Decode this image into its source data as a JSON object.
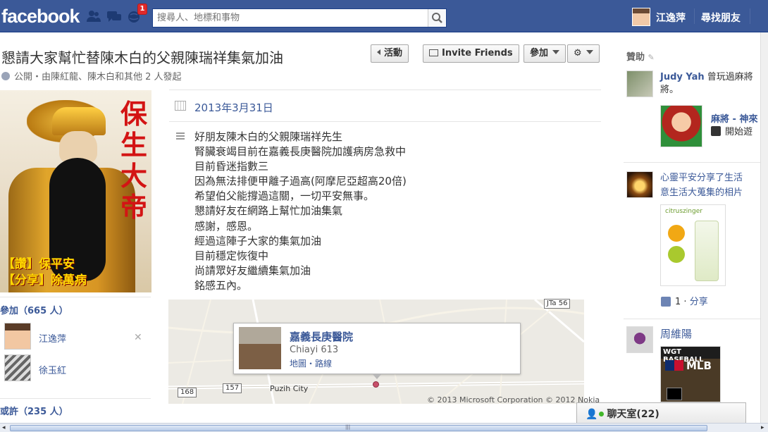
{
  "topbar": {
    "logo": "facebook",
    "notification_count": "1",
    "search_placeholder": "搜尋人、地標和事物",
    "user_name": "江逸萍",
    "find_friends": "尋找朋友"
  },
  "event": {
    "title": "懇請大家幫忙替陳木白的父親陳瑞祥集氣加油",
    "meta": "公開・由陳紅龍、陳木白和其他 2 人發起",
    "buttons": {
      "activity": "活動",
      "invite": "Invite Friends",
      "join": "參加"
    },
    "date": "2013年3月31日",
    "description": [
      "好朋友陳木白的父親陳瑞祥先生",
      "腎臟衰竭目前在嘉義長庚醫院加護病房急救中",
      "目前昏迷指數三",
      "因為無法排便甲離子過高(阿摩尼亞超高20倍)",
      "希望伯父能撐過這關，一切平安無事。",
      "懇請好友在網路上幫忙加油集氣",
      "感謝，感恩。",
      "經過這陣子大家的集氣加油",
      "目前穩定恢復中",
      "尚請眾好友繼續集氣加油",
      "銘感五內。"
    ]
  },
  "poster": {
    "vertical_text": "保生大帝",
    "line1": "【讚】保平安",
    "line2": "【分享】除萬病"
  },
  "left": {
    "going_header": "參加（665 人）",
    "people": [
      "江逸萍",
      "徐玉紅"
    ],
    "maybe_header": "或許（235 人）"
  },
  "map": {
    "place_name": "嘉義長庚醫院",
    "city": "Chiayi 613",
    "links": "地圖・路線",
    "town": "Puzih City",
    "roads": [
      "JTa 56",
      "168",
      "157"
    ],
    "copyright": "© 2013 Microsoft Corporation © 2012 Nokia"
  },
  "right": {
    "sponsored": "贊助",
    "ad1_name": "Judy Yah",
    "ad1_text_a": "曾玩過麻將",
    "ad1_text_b": "將。",
    "ad1_game": "麻將 - 神來",
    "ad1_action": "開始遊",
    "ad2_text_a": "心靈平安分享了生活",
    "ad2_text_b": "意生活大蒐集的相片",
    "ad2_brand": "citruszinger",
    "ad2_likes": "1",
    "ad2_share": "分享",
    "ad3_name": "周維陽",
    "ad3_title": "WGT BASEBALL",
    "ad3_mlb": "MLB"
  },
  "chat": {
    "label": "聊天室(22)"
  },
  "colors": {
    "fb_blue": "#3b5998",
    "notification_red": "#e02a2a"
  }
}
